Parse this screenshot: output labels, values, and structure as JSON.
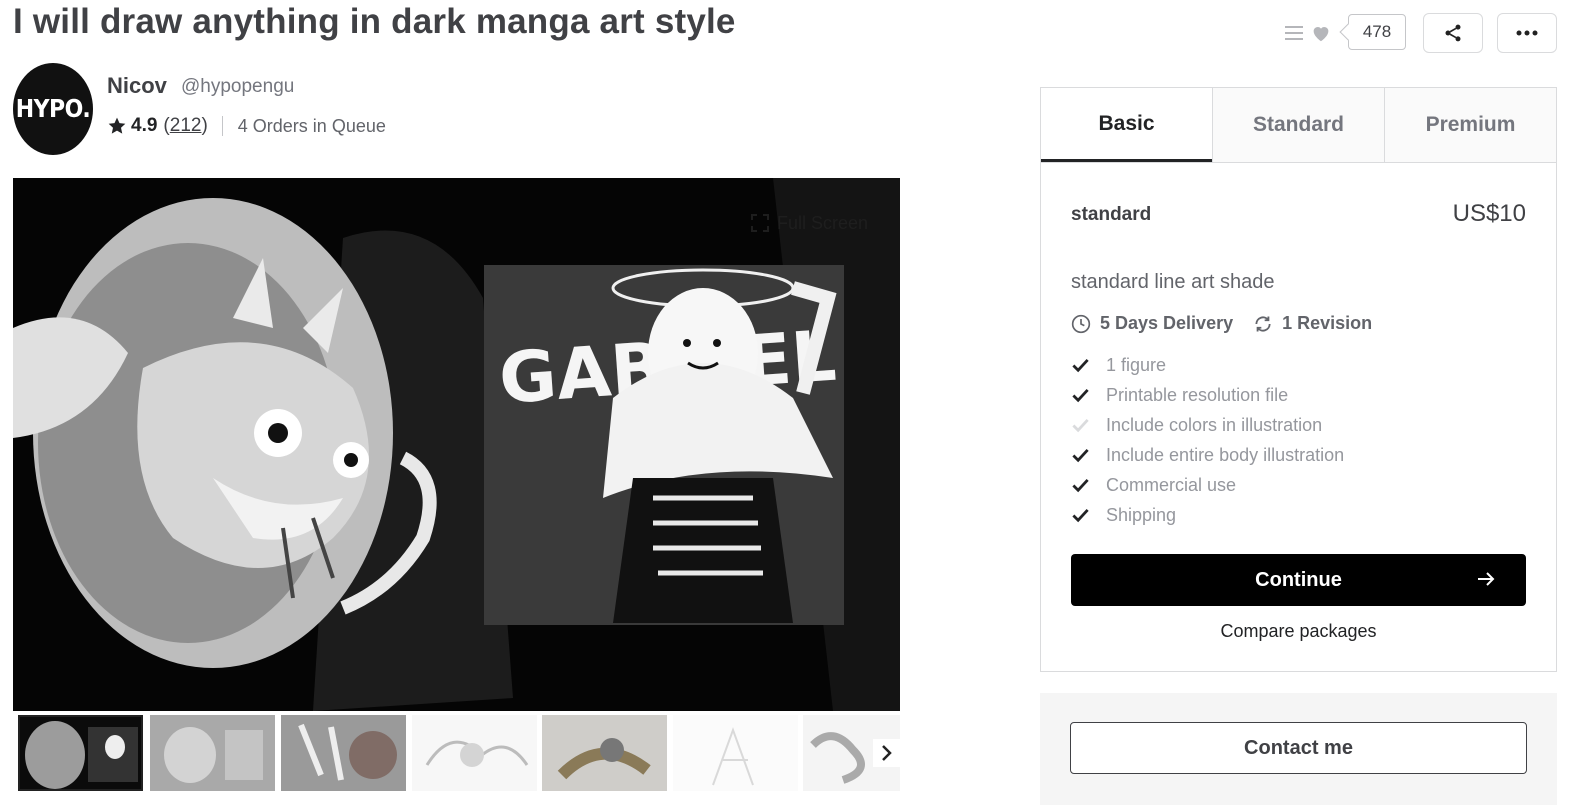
{
  "gig": {
    "title": "I will draw anything in dark manga art style"
  },
  "actions": {
    "save_count": "478"
  },
  "seller": {
    "avatar_text": "HYPO.",
    "name": "Nicov",
    "handle": "@hypopengu",
    "rating": "4.9",
    "reviews_open": "(",
    "reviews_count": "212",
    "reviews_close": ")",
    "orders_in_queue": "4 Orders in Queue"
  },
  "gallery": {
    "fullscreen_label": "Full Screen",
    "art_lettering": "GABRIEL",
    "thumbnails": [
      {
        "tone": "#2a2a2a",
        "active": true
      },
      {
        "tone": "#a9a9a9"
      },
      {
        "tone": "#9a9a9a"
      },
      {
        "tone": "#e8e8e8"
      },
      {
        "tone": "#c2c0bd"
      },
      {
        "tone": "#f0f0f0"
      },
      {
        "tone": "#e2e2e2"
      }
    ]
  },
  "packages": {
    "tabs": [
      {
        "label": "Basic",
        "active": true
      },
      {
        "label": "Standard"
      },
      {
        "label": "Premium"
      }
    ],
    "selected": {
      "name": "standard",
      "price": "US$10",
      "description": "standard line art shade",
      "delivery": "5 Days Delivery",
      "revisions": "1 Revision",
      "features": [
        {
          "label": "1 figure",
          "included": true
        },
        {
          "label": "Printable resolution file",
          "included": true
        },
        {
          "label": "Include colors in illustration",
          "included": false
        },
        {
          "label": "Include entire body illustration",
          "included": true
        },
        {
          "label": "Commercial use",
          "included": true
        },
        {
          "label": "Shipping",
          "included": true
        }
      ]
    },
    "continue_label": "Continue",
    "compare_label": "Compare packages"
  },
  "contact": {
    "label": "Contact me"
  },
  "colors": {
    "text": "#404145",
    "muted": "#95979d",
    "check": "#222325",
    "check_off": "#dadbdd",
    "accent_black": "#000000"
  }
}
